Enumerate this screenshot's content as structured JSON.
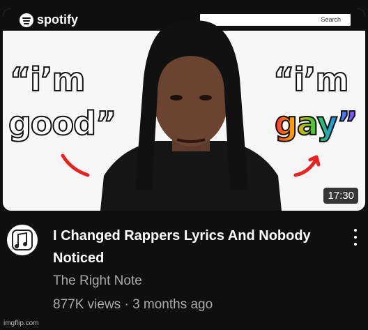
{
  "thumbnail": {
    "brand": "spotify",
    "search_label": "Search",
    "left_quote_top": "“i’m",
    "left_quote_bottom": "good”",
    "right_quote_top": "“i’m",
    "right_quote_bottom": "gay”",
    "duration": "17:30"
  },
  "video": {
    "title": "I Changed Rappers Lyrics And Nobody Noticed",
    "channel": "The Right Note",
    "views": "877K views",
    "separator": "·",
    "age": "3 months ago"
  },
  "watermark": "imgflip.com",
  "colors": {
    "background": "#0f0f0f",
    "title": "#ffffff",
    "meta": "#aaaaaa"
  }
}
